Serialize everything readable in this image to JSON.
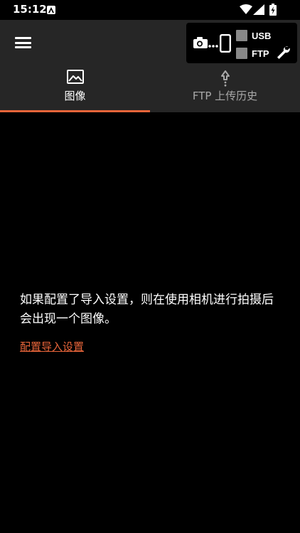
{
  "status_bar": {
    "time": "15:12",
    "icons": [
      "app-notification-icon",
      "wifi-icon",
      "signal-icon",
      "battery-charging-icon"
    ]
  },
  "app_bar": {
    "menu_icon": "hamburger-menu-icon",
    "connection": {
      "camera_icon": "camera-icon",
      "phone_icon": "phone-icon",
      "usb_label": "USB",
      "ftp_label": "FTP",
      "usb_checked": false,
      "ftp_checked": false,
      "settings_icon": "wrench-icon"
    }
  },
  "tabs": [
    {
      "label": "图像",
      "icon": "image-icon",
      "selected": true
    },
    {
      "label": "FTP 上传历史",
      "icon": "upload-icon",
      "selected": false
    }
  ],
  "content": {
    "empty_message": "如果配置了导入设置，则在使用相机进行拍摄后会出现一个图像。",
    "link_label": "配置导入设置"
  },
  "colors": {
    "background": "#000000",
    "bar": "#262626",
    "accent": "#e8653a",
    "inactive_text": "#a8a8a8"
  }
}
